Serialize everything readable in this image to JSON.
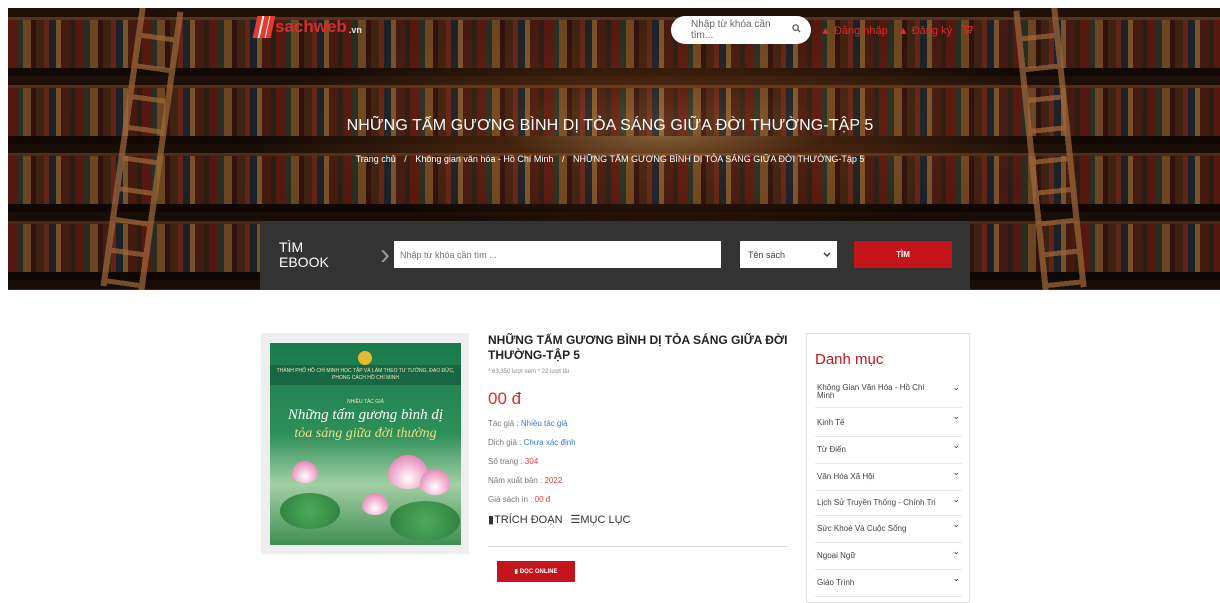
{
  "header": {
    "logo_text": "sachweb",
    "logo_suffix": ".vn",
    "search_placeholder": "Nhập từ khóa cần tìm...",
    "search_icon": "search-icon",
    "login_label": "Đăng nhập",
    "register_label": "Đăng ký",
    "cart_icon": "cart-icon"
  },
  "hero": {
    "title": "NHỮNG TẤM GƯƠNG BÌNH DỊ TỎA SÁNG GIỮA ĐỜI THƯỜNG-TẬP 5",
    "breadcrumb": {
      "home": "Trang chủ",
      "sep": "/",
      "category": "Không gian văn hóa - Hồ Chí Minh",
      "current": "NHỮNG TẤM GƯƠNG BÌNH DỊ TỎA SÁNG GIỮA ĐỜI THƯỜNG-Tập 5"
    }
  },
  "ebook_search": {
    "label_line1": "TÌM",
    "label_line2": "EBOOK",
    "input_placeholder": "Nhập từ khóa cần tìm ...",
    "select_value": "Tên sách",
    "button_label": "TÌM"
  },
  "cover": {
    "top_text": "THÀNH PHỐ HỒ CHÍ MINH HỌC TẬP VÀ LÀM THEO TƯ TƯỞNG, ĐẠO ĐỨC, PHONG CÁCH HỒ CHÍ MINH",
    "author": "NHIỀU TÁC GIẢ",
    "title_line1": "Những tấm gương bình dị",
    "title_line2": "tỏa sáng giữa đời thường"
  },
  "product": {
    "title": "NHỮNG TẤM GƯƠNG BÌNH DỊ TỎA SÁNG GIỮA ĐỜI THƯỜNG-TẬP 5",
    "meta": "* 63,350 lượt xem * 22 lượt tải",
    "price": "00 đ",
    "author_label": "Tác giả : ",
    "author_value": "Nhiều tác giả",
    "translator_label": "Dịch giả : ",
    "translator_value": "Chưa xác định",
    "pages_label": "Số trang : ",
    "pages_value": "304",
    "year_label": "Năm xuất bản : ",
    "year_value": "2022",
    "print_price_label": "Giá sách in : ",
    "print_price_value": "00 đ",
    "excerpt_label": "TRÍCH ĐOẠN",
    "toc_label": "MỤC LỤC",
    "read_online_label": "ĐỌC ONLINE"
  },
  "sidebar": {
    "title": "Danh mục",
    "items": [
      {
        "label": "Không Gian Văn Hóa - Hồ Chí Minh"
      },
      {
        "label": "Kinh Tế"
      },
      {
        "label": "Từ Điển"
      },
      {
        "label": "Văn Hóa Xã Hội"
      },
      {
        "label": "Lịch Sử Truyền Thống - Chính Trị"
      },
      {
        "label": "Sức Khoẻ Và Cuộc Sống"
      },
      {
        "label": "Ngoại Ngữ"
      },
      {
        "label": "Giáo Trình"
      }
    ]
  },
  "colors": {
    "accent_red": "#c4151c",
    "price_red": "#e02a2a",
    "link_blue": "#3a7bd5",
    "search_bar_bg": "#333333"
  }
}
